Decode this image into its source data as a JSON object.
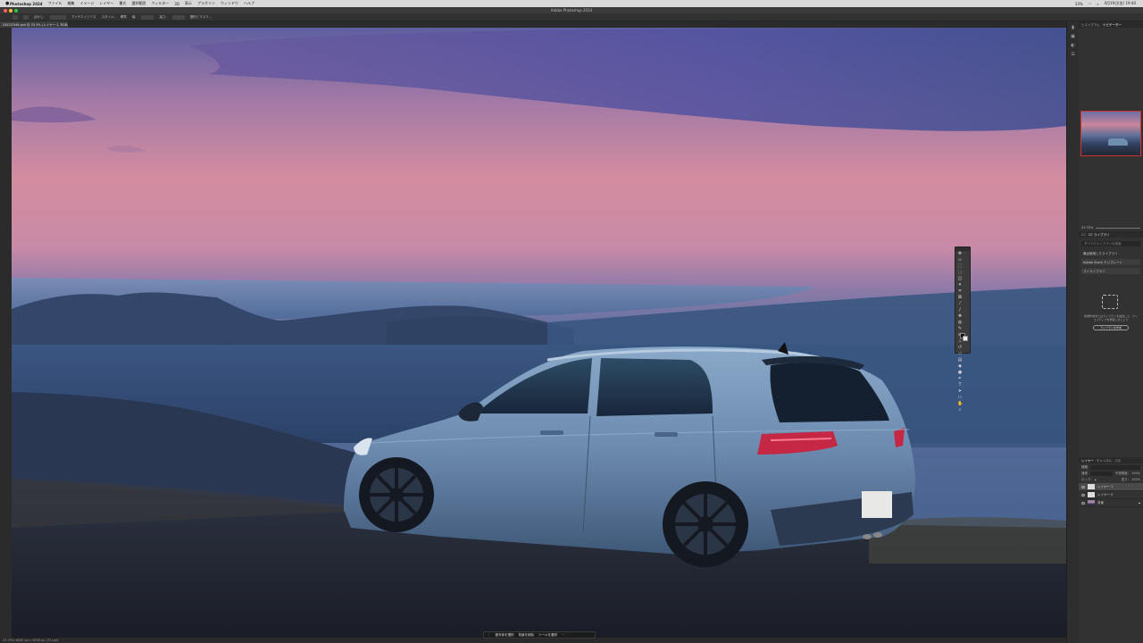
{
  "menubar": {
    "apple": "",
    "app_name": "Photoshop 2024",
    "items": [
      "ファイル",
      "編集",
      "イメージ",
      "レイヤー",
      "書式",
      "選択範囲",
      "フィルター",
      "3D",
      "表示",
      "プラグイン",
      "ウィンドウ",
      "ヘルプ"
    ],
    "clock": "4月19日(金) 19:40",
    "status": "33%"
  },
  "window": {
    "title": "Adobe Photoshop 2024"
  },
  "options_bar": {
    "labels": [
      "ぼかし:",
      "アンチエイリアス",
      "スタイル:",
      "標準",
      "幅:",
      "高さ:",
      "選択とマスク..."
    ]
  },
  "document_tab": {
    "label": "DSC02546.psd @ 33.3% (レイヤー 1, RGB/16)"
  },
  "status_bar": {
    "text": "33.33%   6000 px x 4000 px (72 ppi)"
  },
  "context_bar": {
    "items": [
      "被写体を選択",
      "背景を削除",
      "ツールを選択"
    ]
  },
  "panels": {
    "navigator": {
      "tabs": [
        "ヒストグラム",
        "ナビゲーター"
      ],
      "zoom": "33.33%"
    },
    "libraries": {
      "tabs": [
        "CC",
        "CC ライブラリ"
      ],
      "search_placeholder": "すべてのライブラリを検索",
      "section": "最近使用したライブラリ",
      "rows": [
        "Adobe Stock テンプレート",
        "マイライブラリ"
      ],
      "note": "新規作成またはライブラリを追加して、クリエイティブを整理しましょう",
      "button": "ライブラリを作成"
    },
    "layers": {
      "tabs": [
        "レイヤー",
        "チャンネル",
        "パス"
      ],
      "filter": "種類",
      "blend": "通常",
      "opacity_label": "不透明度:",
      "opacity": "100%",
      "lock_label": "ロック:",
      "fill_label": "塗り:",
      "fill": "100%",
      "rows": [
        {
          "name": "レイヤー 1",
          "active": true,
          "thumb": "white"
        },
        {
          "name": "レイヤー 0",
          "active": false,
          "thumb": "white"
        },
        {
          "name": "背景",
          "active": false,
          "thumb": "photo"
        }
      ]
    }
  }
}
